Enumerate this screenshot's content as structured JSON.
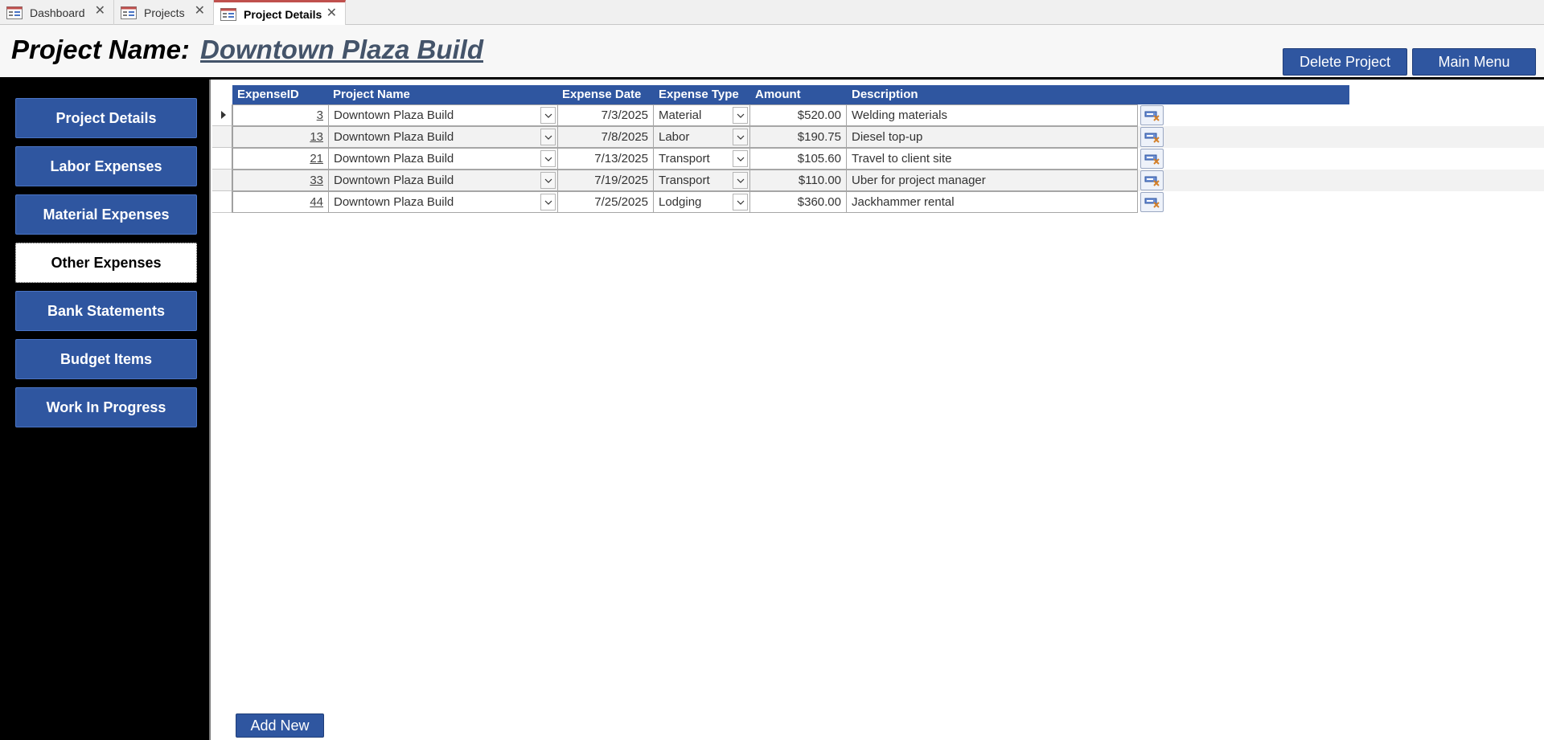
{
  "tabs": [
    {
      "label": "Dashboard"
    },
    {
      "label": "Projects"
    },
    {
      "label": "Project Details"
    }
  ],
  "header": {
    "project_label": "Project Name:",
    "project_name": "Downtown Plaza Build",
    "delete_button": "Delete Project",
    "main_menu_button": "Main Menu"
  },
  "sidebar": {
    "items": [
      {
        "label": "Project Details"
      },
      {
        "label": "Labor Expenses"
      },
      {
        "label": "Material Expenses"
      },
      {
        "label": "Other Expenses"
      },
      {
        "label": "Bank Statements"
      },
      {
        "label": "Budget Items"
      },
      {
        "label": "Work In Progress"
      }
    ],
    "selected": "Other Expenses"
  },
  "grid": {
    "columns": [
      "ExpenseID",
      "Project Name",
      "Expense Date",
      "Expense Type",
      "Amount",
      "Description"
    ],
    "rows": [
      {
        "id": "3",
        "project": "Downtown Plaza Build",
        "date": "7/3/2025",
        "type": "Material",
        "amount": "$520.00",
        "description": "Welding materials"
      },
      {
        "id": "13",
        "project": "Downtown Plaza Build",
        "date": "7/8/2025",
        "type": "Labor",
        "amount": "$190.75",
        "description": "Diesel top-up"
      },
      {
        "id": "21",
        "project": "Downtown Plaza Build",
        "date": "7/13/2025",
        "type": "Transport",
        "amount": "$105.60",
        "description": "Travel to client site"
      },
      {
        "id": "33",
        "project": "Downtown Plaza Build",
        "date": "7/19/2025",
        "type": "Transport",
        "amount": "$110.00",
        "description": "Uber for project manager"
      },
      {
        "id": "44",
        "project": "Downtown Plaza Build",
        "date": "7/25/2025",
        "type": "Lodging",
        "amount": "$360.00",
        "description": "Jackhammer rental"
      }
    ]
  },
  "footer": {
    "add_new_button": "Add New"
  },
  "colors": {
    "accent_blue": "#2f56a0",
    "sidebar_bg": "#000000",
    "title_value": "#44546a",
    "active_tab_line": "#c0504d"
  },
  "icons": {
    "tab_form_icon": "form-icon",
    "row_delete_icon": "delete-record-icon",
    "dropdown_icon": "chevron-down-icon",
    "current_record_icon": "record-selector-arrow-icon"
  }
}
